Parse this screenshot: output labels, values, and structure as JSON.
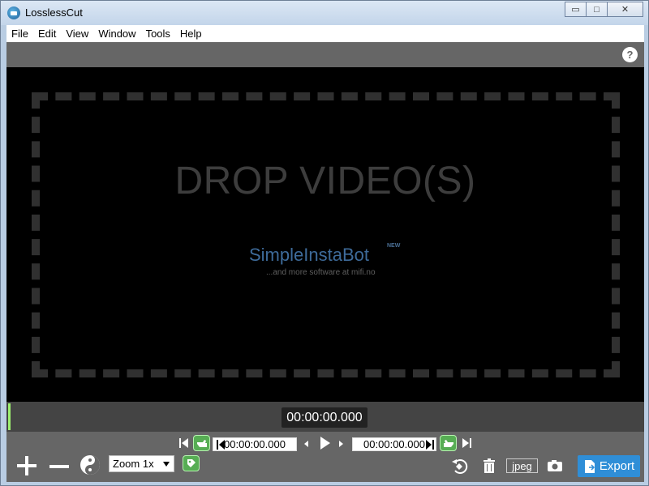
{
  "window": {
    "title": "LosslessCut",
    "buttons": {
      "minimize": "▭",
      "maximize": "□",
      "close": "✕"
    }
  },
  "menu": {
    "items": [
      "File",
      "Edit",
      "View",
      "Window",
      "Tools",
      "Help"
    ]
  },
  "toolbar": {
    "help_icon": "help-icon",
    "help_label": "?"
  },
  "stage": {
    "drop_text": "DROP VIDEO(S)",
    "brand": "SimpleInstaBot",
    "badge": "NEW",
    "subline": "...and more software at mifi.no"
  },
  "timeline": {
    "current_time": "00:00:00.000"
  },
  "controls": {
    "start_time": "00:00:00.000",
    "end_time": "00:00:00.000",
    "zoom_label": "Zoom 1x",
    "format": "jpeg",
    "export_label": "Export"
  },
  "icons": {
    "plus": "plus-icon",
    "minus": "minus-icon",
    "yin_yang": "yin-yang-icon",
    "tag": "tag-icon",
    "play": "play-icon",
    "prev": "previous-frame-icon",
    "next": "next-frame-icon",
    "rotate": "rotate-icon",
    "trash": "trash-icon",
    "camera": "camera-icon"
  }
}
